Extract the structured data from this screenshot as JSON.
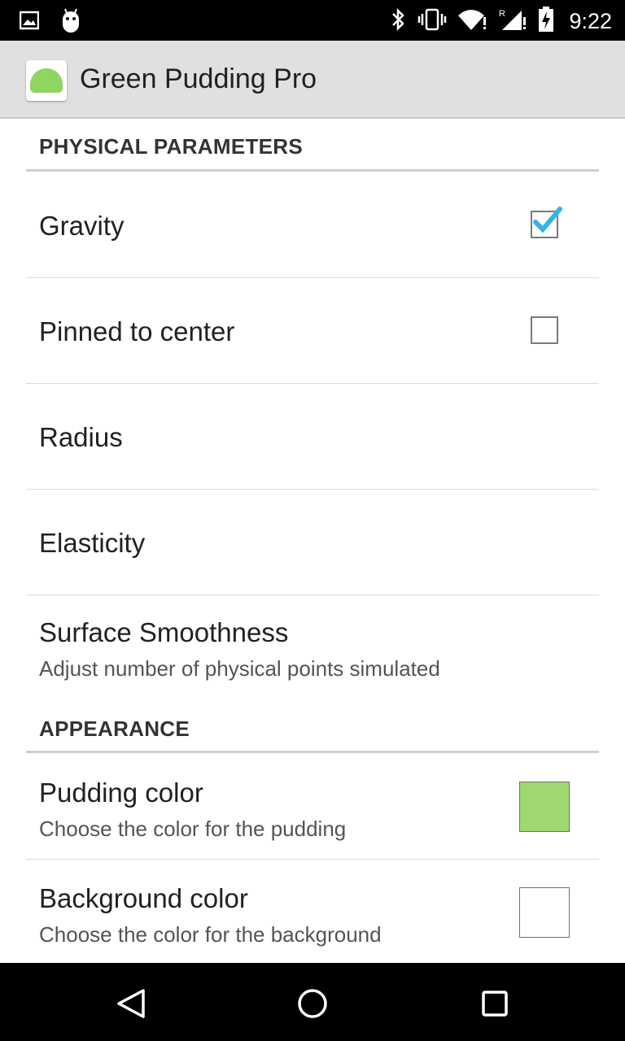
{
  "status_bar": {
    "time": "9:22",
    "icons_left": [
      "image-icon",
      "android-debug-icon"
    ],
    "icons_right": [
      "bluetooth-icon",
      "vibrate-icon",
      "wifi-icon",
      "signal-roaming-icon",
      "battery-charging-icon"
    ]
  },
  "action_bar": {
    "title": "Green Pudding Pro",
    "icon": "pudding-app-icon"
  },
  "sections": [
    {
      "header": "PHYSICAL PARAMETERS",
      "items": [
        {
          "title": "Gravity",
          "checked": true
        },
        {
          "title": "Pinned to center",
          "checked": false
        },
        {
          "title": "Radius"
        },
        {
          "title": "Elasticity"
        },
        {
          "title": "Surface Smoothness",
          "summary": "Adjust number of physical points simulated"
        }
      ]
    },
    {
      "header": "APPEARANCE",
      "items": [
        {
          "title": "Pudding color",
          "summary": "Choose the color for the pudding",
          "color": "#9ed86f"
        },
        {
          "title": "Background color",
          "summary": "Choose the color for the background",
          "color": "#ffffff"
        }
      ]
    }
  ],
  "nav_bar": {
    "buttons": [
      "back-icon",
      "home-icon",
      "recents-icon"
    ]
  },
  "colors": {
    "checkbox_accent": "#33b5e5",
    "action_bar": "#e0e0e0",
    "pudding_green": "#9ed86f"
  }
}
